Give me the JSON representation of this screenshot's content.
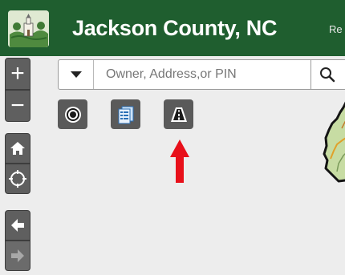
{
  "header": {
    "title": "Jackson County, NC",
    "cut_label": "Re"
  },
  "nav": {
    "zoom_in_label": "+",
    "zoom_out_label": "−"
  },
  "search": {
    "placeholder": "Owner, Address,or PIN",
    "value": ""
  },
  "icons": {
    "logo": "county-seal-logo",
    "dropdown": "caret-down-icon",
    "search": "search-icon",
    "home": "home-icon",
    "locate": "locate-crosshair-icon",
    "back": "arrow-left-icon",
    "forward": "arrow-right-icon",
    "tool_1": "concentric-circles-icon",
    "tool_2": "document-list-icon",
    "tool_3": "road-icon",
    "annotation": "red-arrow-up-icon"
  },
  "colors": {
    "header_bg": "#1f5e2f",
    "button_bg": "#5a5a5a",
    "annotation": "#e8101a",
    "map_bg": "#ededed"
  }
}
